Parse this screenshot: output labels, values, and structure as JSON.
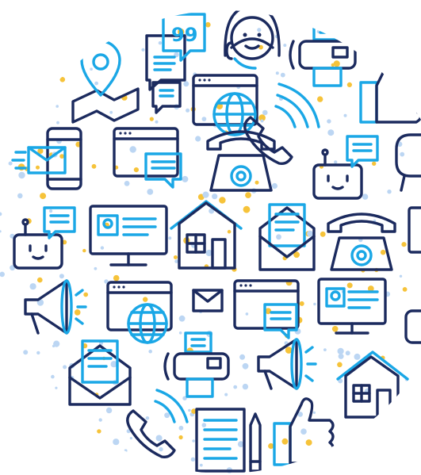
{
  "colors": {
    "navy": "#1b2a5e",
    "blue": "#1aa7e6",
    "yellow": "#f6c33a",
    "dot_blue": "#bcd6f3",
    "background": "#ffffff"
  },
  "illustration": {
    "style": "line-icon collage",
    "icons": [
      "speech-bubbles-icon",
      "support-agent-headset-icon",
      "fax-machine-icon",
      "location-pin-map-icon",
      "browser-window-icon",
      "globe-icon",
      "thumbs-up-icon",
      "chat-bubble-icon",
      "smartphone-email-icon",
      "browser-chat-icon",
      "telephone-receiver-icon",
      "desk-phone-icon",
      "chatbot-icon",
      "megaphone-icon",
      "contact-card-monitor-icon",
      "house-icon",
      "open-envelope-icon",
      "document-icon",
      "pencil-icon",
      "envelope-icon"
    ]
  }
}
